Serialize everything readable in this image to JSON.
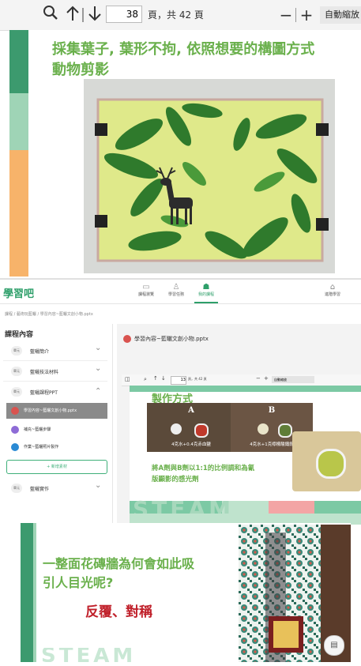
{
  "viewer": {
    "search_icon": "search-icon",
    "prev_page_icon": "arrow-up-icon",
    "next_page_icon": "arrow-down-icon",
    "current_page": "38",
    "page_suffix": "頁，共 42 頁",
    "zoom_out": "−",
    "zoom_in": "+",
    "zoom_value": "自動縮放"
  },
  "slide1": {
    "title_line1": "採集葉子, 葉形不拘, 依照想要的構圖方式",
    "title_line2": "動物剪影"
  },
  "lms": {
    "logo": "學習吧",
    "nav": [
      {
        "label": "課程瀏覽",
        "icon": "laptop-icon"
      },
      {
        "label": "學習任務",
        "icon": "person-icon"
      },
      {
        "label": "我的課程",
        "icon": "group-icon"
      }
    ],
    "user_label": "進階學習",
    "breadcrumb": "課程 / 藝術玩藍曬 / 學習內容~藍曬文創小物.pptx",
    "sidebar_title": "課程內容",
    "sidebar_items": [
      {
        "badge": "單元",
        "label": "藍曬簡介",
        "chev": "⌄"
      },
      {
        "badge": "單元",
        "label": "藍曬技法材料",
        "chev": "⌄"
      },
      {
        "badge": "單元",
        "label": "藍曬課程PPT",
        "chev": "⌃"
      }
    ],
    "sub_items": [
      {
        "label": "學習內容~藍曬文創小物.pptx",
        "active": true,
        "color": "#d9534f"
      },
      {
        "label": "補充~藍曬步驟",
        "active": false,
        "color": "#8e6bd6"
      },
      {
        "label": "作業~藍曬照片製作",
        "active": false,
        "color": "#2a8ad4"
      }
    ],
    "add_button": "+ 新增素材",
    "last_item": {
      "badge": "單元",
      "label": "藍曬實作",
      "chev": "⌄"
    },
    "content_title": "學習內容~藍曬文創小物.pptx",
    "mini_toolbar": {
      "page": "13",
      "suffix": "頁，共 42 頁",
      "zoom": "自動縮放"
    },
    "slide": {
      "heading": "製作方式",
      "label_a": "A",
      "label_b": "B",
      "caption_a": "4克水+0.4克赤血鹽",
      "caption_b": "4克水+1克檸檬酸鐵銨",
      "body_line1": "將A劑與B劑以1:1的比例調和為氰",
      "body_line2": "版顯影的感光劑",
      "footer_word": "STEAM"
    }
  },
  "slide3": {
    "question_line1": "一整面花磚牆為何會如此吸",
    "question_line2": "引人目光呢?",
    "answer": "反覆、對稱",
    "footer_word": "STEAM"
  }
}
